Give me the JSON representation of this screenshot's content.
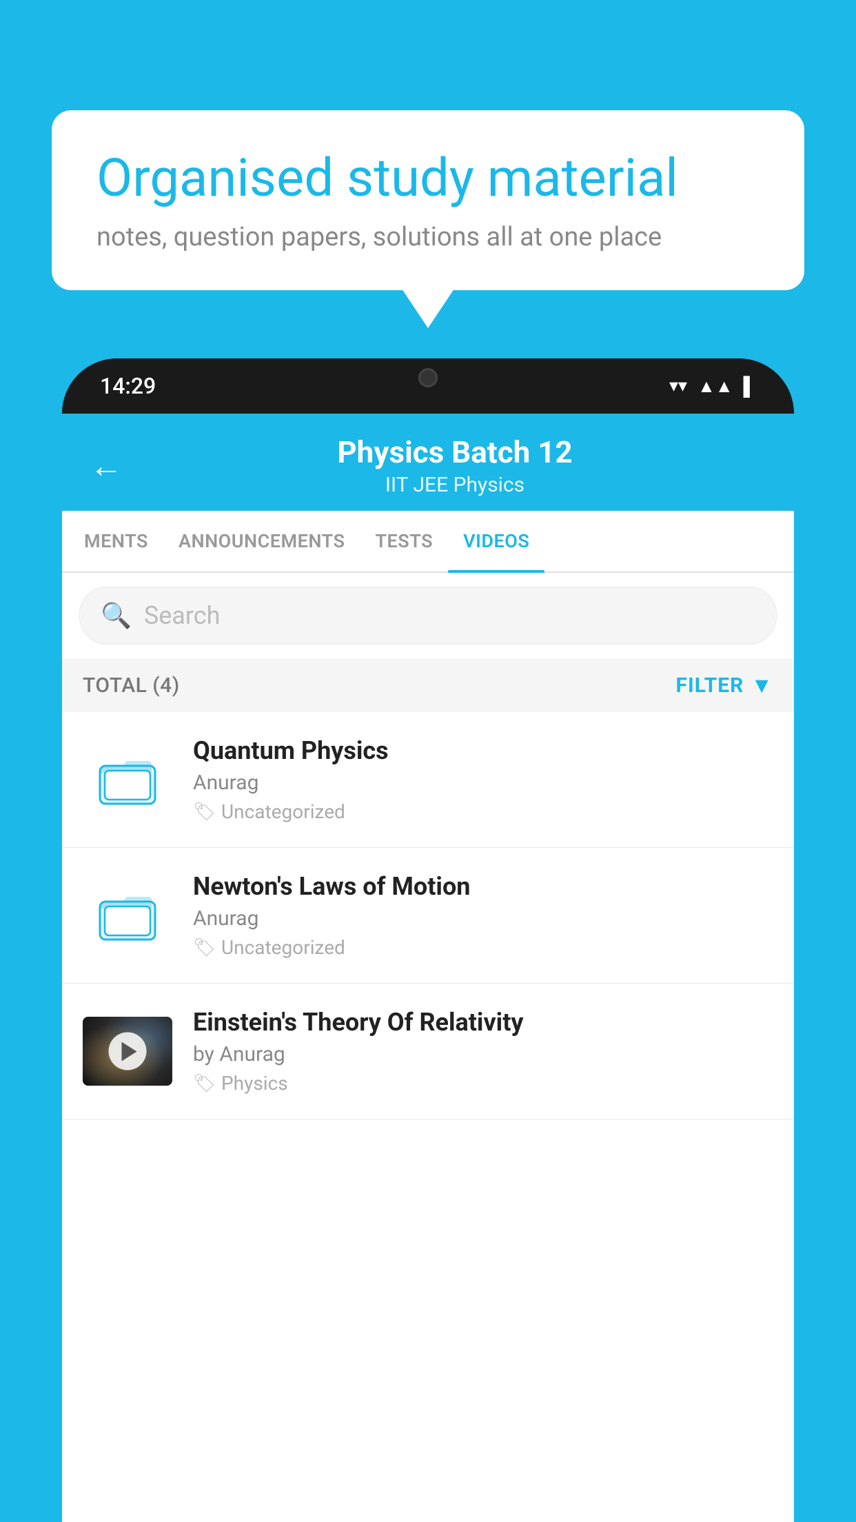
{
  "background": {
    "color": "#1bb8e8"
  },
  "speech_bubble": {
    "title": "Organised study material",
    "subtitle": "notes, question papers, solutions all at one place"
  },
  "phone": {
    "status_bar": {
      "time": "14:29"
    },
    "header": {
      "title": "Physics Batch 12",
      "tags": "IIT JEE   Physics",
      "back_label": "←"
    },
    "tabs": [
      {
        "label": "MENTS",
        "active": false
      },
      {
        "label": "ANNOUNCEMENTS",
        "active": false
      },
      {
        "label": "TESTS",
        "active": false
      },
      {
        "label": "VIDEOS",
        "active": true
      }
    ],
    "search": {
      "placeholder": "Search"
    },
    "filter_bar": {
      "total_label": "TOTAL (4)",
      "filter_label": "FILTER"
    },
    "videos": [
      {
        "title": "Quantum Physics",
        "author": "Anurag",
        "tag": "Uncategorized",
        "type": "folder"
      },
      {
        "title": "Newton's Laws of Motion",
        "author": "Anurag",
        "tag": "Uncategorized",
        "type": "folder"
      },
      {
        "title": "Einstein's Theory Of Relativity",
        "author": "by Anurag",
        "tag": "Physics",
        "type": "video"
      }
    ]
  }
}
